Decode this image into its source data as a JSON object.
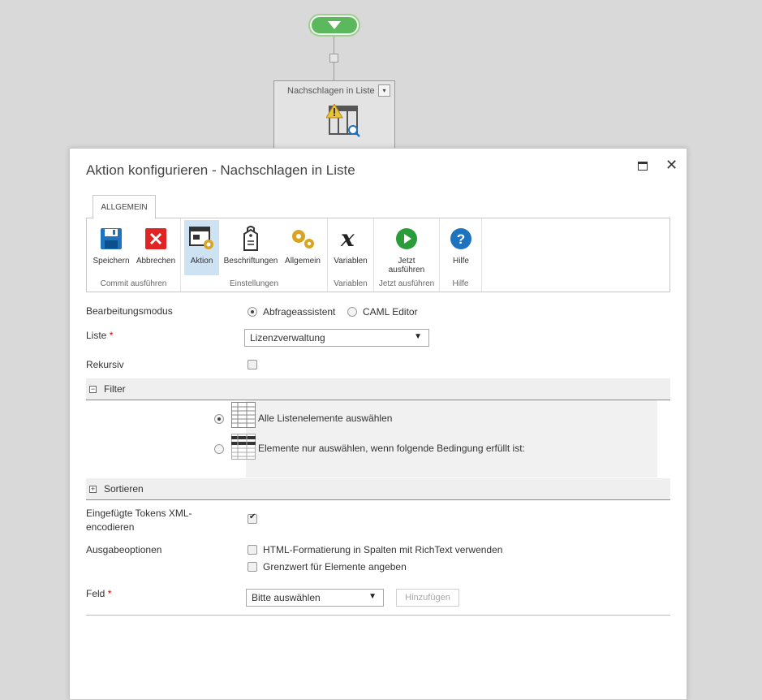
{
  "canvas": {
    "action_node_title": "Nachschlagen in Liste",
    "action_node_dropdown": "▾"
  },
  "dialog": {
    "title": "Aktion konfigurieren - Nachschlagen in Liste",
    "maximize_icon": "maximize-icon",
    "close_label": "✕"
  },
  "ribbon": {
    "tab_label": "ALLGEMEIN",
    "groups": {
      "commit": "Commit ausführen",
      "einstellungen": "Einstellungen",
      "variablen": "Variablen",
      "jetzt": "Jetzt ausführen",
      "hilfe": "Hilfe"
    },
    "buttons": {
      "speichern": "Speichern",
      "abbrechen": "Abbrechen",
      "aktion": "Aktion",
      "beschriftungen": "Beschriftungen",
      "allgemein": "Allgemein",
      "variablen": "Variablen",
      "jetzt_line1": "Jetzt",
      "jetzt_line2": "ausführen",
      "hilfe": "Hilfe"
    }
  },
  "form": {
    "bearbeitungsmodus": {
      "label": "Bearbeitungsmodus",
      "option1": "Abfrageassistent",
      "option2": "CAML Editor",
      "selected": "Abfrageassistent"
    },
    "liste": {
      "label": "Liste",
      "required": "*",
      "value": "Lizenzverwaltung"
    },
    "rekursiv": {
      "label": "Rekursiv",
      "checked": false
    },
    "filter": {
      "section_title": "Filter",
      "toggle": "−",
      "option_all": "Alle Listenelemente auswählen",
      "option_condition": "Elemente nur auswählen, wenn folgende Bedingung erfüllt ist:",
      "selected": "all"
    },
    "sortieren": {
      "section_title": "Sortieren",
      "toggle": "+"
    },
    "tokens": {
      "label_line1": "Eingefügte Tokens XML-",
      "label_line2": "encodieren",
      "checked": true
    },
    "ausgabe": {
      "label": "Ausgabeoptionen",
      "option1": "HTML-Formatierung in Spalten mit RichText verwenden",
      "option2": "Grenzwert für Elemente angeben"
    },
    "feld": {
      "label": "Feld",
      "required": "*",
      "value": "Bitte auswählen",
      "add_button": "Hinzufügen"
    }
  },
  "colors": {
    "start_node": "#5cb85c",
    "save_icon": "#1e73be",
    "cancel_icon": "#e02424",
    "run_icon": "#2a9d3a",
    "help_icon": "#1e73be",
    "gear_icon": "#d9a521",
    "active_tab": "#cde3f4"
  }
}
